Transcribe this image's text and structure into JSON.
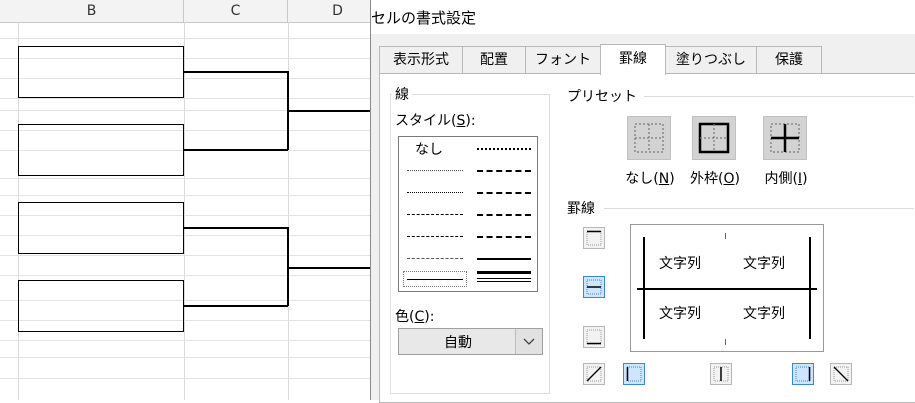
{
  "sheet": {
    "columns": [
      "B",
      "C",
      "D"
    ]
  },
  "dialog": {
    "title": "セルの書式設定",
    "tabs": [
      {
        "label": "表示形式"
      },
      {
        "label": "配置"
      },
      {
        "label": "フォント"
      },
      {
        "label": "罫線",
        "active": true
      },
      {
        "label": "塗りつぶし"
      },
      {
        "label": "保護"
      }
    ],
    "line_group": {
      "label": "線",
      "style_label": "スタイル(",
      "style_key": "S",
      "style_label_end": "):",
      "none_label": "なし",
      "color_label": "色(",
      "color_key": "C",
      "color_label_end": "):",
      "color_value": "自動"
    },
    "preset_group": {
      "label": "プリセット",
      "none": {
        "label": "なし(",
        "key": "N",
        "end": ")"
      },
      "outline": {
        "label": "外枠(",
        "key": "O",
        "end": ")"
      },
      "inside": {
        "label": "内側(",
        "key": "I",
        "end": ")"
      }
    },
    "border_group": {
      "label": "罫線",
      "preview_text": [
        "文字列",
        "文字列",
        "文字列",
        "文字列"
      ]
    }
  },
  "colors": {
    "dialog_bg": "#f0f0f0",
    "panel_bg": "#ffffff",
    "active_border_button": "#cfe5fb",
    "active_border_button_edge": "#3a86d8"
  }
}
